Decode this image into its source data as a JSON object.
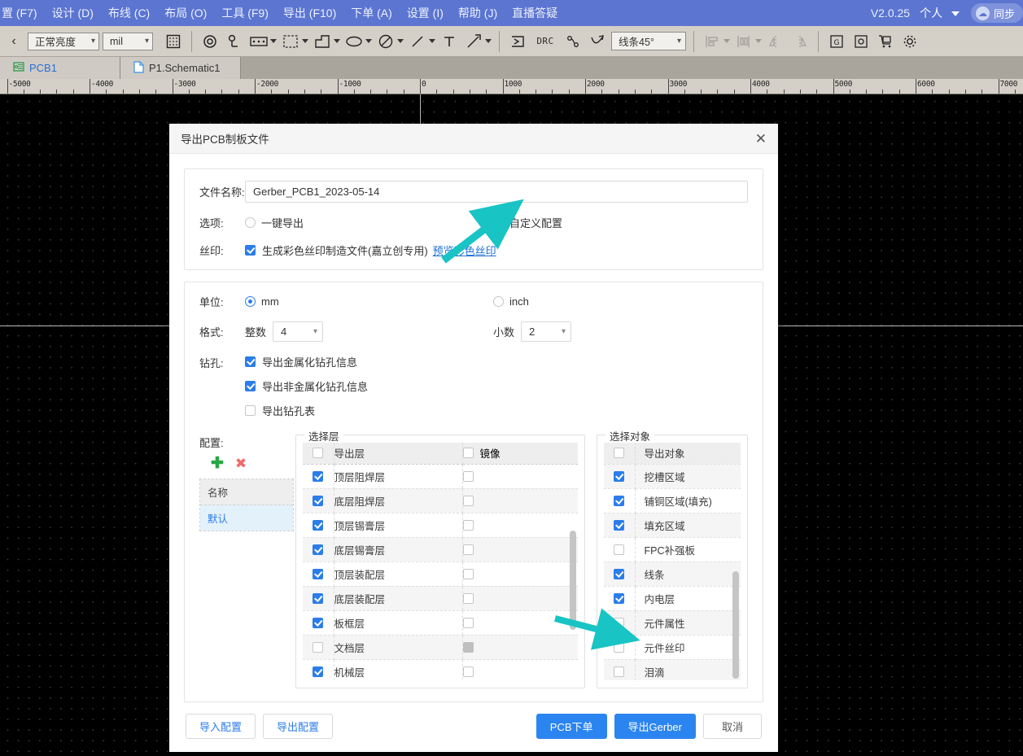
{
  "menubar": {
    "items": [
      "置 (F7)",
      "设计 (D)",
      "布线 (C)",
      "布局 (O)",
      "工具 (F9)",
      "导出 (F10)",
      "下单 (A)",
      "设置 (I)",
      "帮助 (J)",
      "直播答疑"
    ],
    "version": "V2.0.25",
    "account": "个人",
    "sync_label": "同步",
    "bg_color": "#5b75d1"
  },
  "toolbar": {
    "brightness_select": "正常亮度",
    "unit_select": "mil",
    "angle_select": "线条45°",
    "icons": [
      "grid-icon",
      "via-icon",
      "pad-icon",
      "rect-area-icon",
      "dashed-area-icon",
      "polygon-icon",
      "ellipse-icon",
      "forbid-icon",
      "line-icon",
      "text-icon",
      "dimension-icon",
      "place-icon",
      "drc-icon",
      "route-icon",
      "fanout-icon",
      "align-icon",
      "distribute-icon",
      "flip-h-icon",
      "flip-v-icon",
      "gerber-folder-icon",
      "preview-folder-icon",
      "cart-icon",
      "settings-gear-icon"
    ],
    "drc_label": "DRC"
  },
  "tabs": [
    {
      "label": "PCB1",
      "icon": "pcb-icon",
      "active": true
    },
    {
      "label": "P1.Schematic1",
      "icon": "schematic-doc-icon",
      "active": false
    }
  ],
  "ruler": {
    "labels": [
      "-5000",
      "-4000",
      "-3000",
      "-2000",
      "-1000",
      "0",
      "1000",
      "2000",
      "3000",
      "4000",
      "5000",
      "6000",
      "7000"
    ],
    "unit": "mil"
  },
  "dialog": {
    "title": "导出PCB制板文件",
    "close_icon": "close-icon",
    "file": {
      "label": "文件名称:",
      "value": "Gerber_PCB1_2023-05-14"
    },
    "option": {
      "label": "选项:",
      "radios": [
        {
          "label": "一键导出",
          "selected": false
        },
        {
          "label": "自定义配置",
          "selected": true
        }
      ]
    },
    "silkscreen": {
      "label": "丝印:",
      "checkbox_label": "生成彩色丝印制造文件(嘉立创专用)",
      "checked": true,
      "link_label": "预览彩色丝印"
    },
    "unit": {
      "label": "单位:",
      "radios": [
        {
          "label": "mm",
          "selected": true
        },
        {
          "label": "inch",
          "selected": false
        }
      ]
    },
    "format": {
      "label": "格式:",
      "integer_label": "整数",
      "integer_value": "4",
      "decimal_label": "小数",
      "decimal_value": "2"
    },
    "drill": {
      "label": "钻孔:",
      "items": [
        {
          "label": "导出金属化钻孔信息",
          "checked": true
        },
        {
          "label": "导出非金属化钻孔信息",
          "checked": true
        },
        {
          "label": "导出钻孔表",
          "checked": false
        }
      ]
    },
    "config": {
      "label": "配置:",
      "add_icon": "plus-icon",
      "delete_icon": "delete-x-icon",
      "column_header": "名称",
      "rows": [
        {
          "label": "默认",
          "selected": true
        }
      ]
    },
    "layers": {
      "legend": "选择层",
      "header": {
        "export": "导出层",
        "mirror": "镜像",
        "export_checked": false,
        "mirror_checked": false
      },
      "rows": [
        {
          "label": "顶层阻焊层",
          "checked": true,
          "mirror": false,
          "mirror_disabled": false
        },
        {
          "label": "底层阻焊层",
          "checked": true,
          "mirror": false,
          "mirror_disabled": false
        },
        {
          "label": "顶层锡膏层",
          "checked": true,
          "mirror": false,
          "mirror_disabled": false
        },
        {
          "label": "底层锡膏层",
          "checked": true,
          "mirror": false,
          "mirror_disabled": false
        },
        {
          "label": "顶层装配层",
          "checked": true,
          "mirror": false,
          "mirror_disabled": false
        },
        {
          "label": "底层装配层",
          "checked": true,
          "mirror": false,
          "mirror_disabled": false
        },
        {
          "label": "板框层",
          "checked": true,
          "mirror": false,
          "mirror_disabled": false
        },
        {
          "label": "文档层",
          "checked": false,
          "mirror": false,
          "mirror_disabled": true
        },
        {
          "label": "机械层",
          "checked": true,
          "mirror": false,
          "mirror_disabled": false
        }
      ]
    },
    "objects": {
      "legend": "选择对象",
      "header": {
        "label": "导出对象",
        "checked": false
      },
      "rows": [
        {
          "label": "挖槽区域",
          "checked": true
        },
        {
          "label": "铺铜区域(填充)",
          "checked": true
        },
        {
          "label": "填充区域",
          "checked": true
        },
        {
          "label": "FPC补强板",
          "checked": false
        },
        {
          "label": "线条",
          "checked": true
        },
        {
          "label": "内电层",
          "checked": true
        },
        {
          "label": "元件属性",
          "checked": false
        },
        {
          "label": "元件丝印",
          "checked": false
        },
        {
          "label": "泪滴",
          "checked": false
        }
      ]
    },
    "footer": {
      "import_config": "导入配置",
      "export_config": "导出配置",
      "order": "PCB下单",
      "export_gerber": "导出Gerber",
      "cancel": "取消"
    }
  },
  "annotations": {
    "arrow_color": "#18c4c4",
    "arrows": [
      "arrow-to-custom-config",
      "arrow-to-object-list"
    ]
  }
}
